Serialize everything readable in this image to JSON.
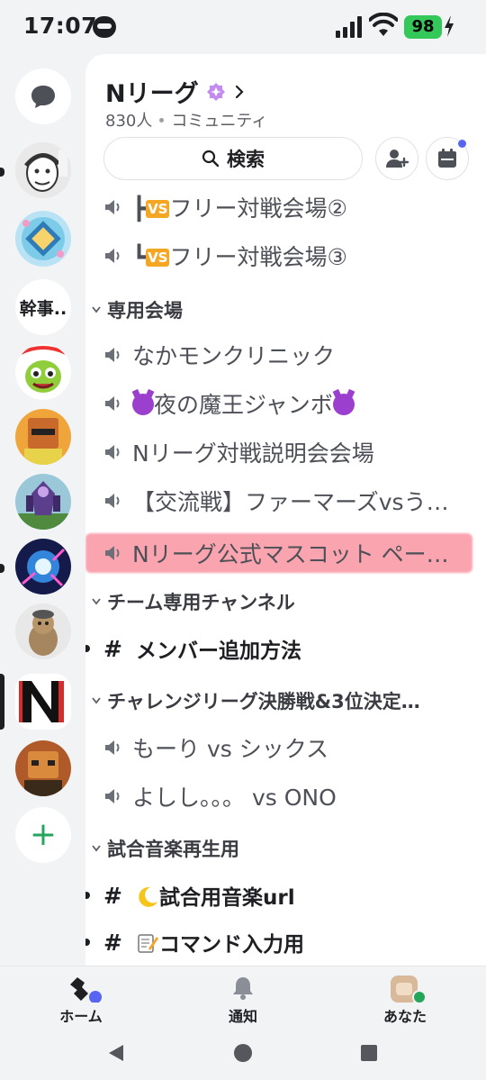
{
  "status_bar": {
    "time": "17:07",
    "battery": "98"
  },
  "rail": {
    "text_server_label": "幹事..",
    "add_label": "+"
  },
  "guild": {
    "name": "Nリーグ",
    "member_count": "830人",
    "type": "コミュニティ",
    "search_label": "検索"
  },
  "channels": {
    "voice_top_1": "フリー対戦会場②",
    "voice_top_2": "フリー対戦会場③",
    "prefix_1": "┣",
    "prefix_2": "┗",
    "vs_badge": "VS",
    "cat_1": "専用会場",
    "cat_1_items": [
      "なかモンクリニック",
      "夜の魔王ジャンボ",
      "Nリーグ対戦説明会会場",
      "【交流戦】ファーマーズvsう…",
      "Nリーグ公式マスコット ペー…"
    ],
    "cat_2": "チーム専用チャンネル",
    "cat_2_text": "メンバー追加方法",
    "cat_3": "チャレンジリーグ決勝戦&3位決定…",
    "cat_3_items": [
      "もーり vs シックス",
      "よしし。。。 vs  ONO"
    ],
    "cat_4": "試合音楽再生用",
    "cat_4_text_1": "試合用音楽url",
    "cat_4_text_2": "コマンド入力用",
    "hash": "#"
  },
  "bottom_nav": {
    "home": "ホーム",
    "notifications": "通知",
    "you": "あなた"
  },
  "colors": {
    "accent": "#5865f2",
    "online": "#23a55a",
    "highlight": "#f55a6e",
    "vs_badge": "#f5a623"
  }
}
